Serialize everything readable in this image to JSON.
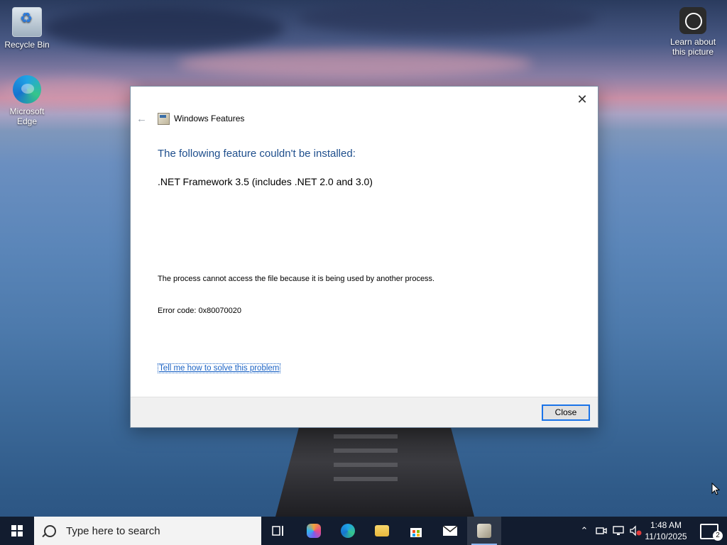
{
  "desktop": {
    "icons": [
      {
        "label": "Recycle Bin"
      },
      {
        "label": "Microsoft Edge"
      },
      {
        "label": "Learn about this picture"
      }
    ]
  },
  "dialog": {
    "window_title": "Windows Features",
    "heading": "The following feature couldn't be installed:",
    "feature": ".NET Framework 3.5 (includes .NET 2.0 and 3.0)",
    "message": "The process cannot access the file because it is being used by another process.",
    "error_code": "Error code: 0x80070020",
    "help_link": "Tell me how to solve this problem",
    "close_button": "Close",
    "close_glyph": "✕",
    "back_glyph": "←"
  },
  "taskbar": {
    "search_placeholder": "Type here to search",
    "pinned": [
      "task-view",
      "copilot",
      "edge",
      "file-explorer",
      "store",
      "mail",
      "windows-features"
    ],
    "time": "1:48 AM",
    "date": "11/10/2025",
    "notification_count": "2"
  },
  "colors": {
    "heading": "#1e4e8c",
    "link": "#1a62c4",
    "button_focus": "#1a73e8"
  }
}
